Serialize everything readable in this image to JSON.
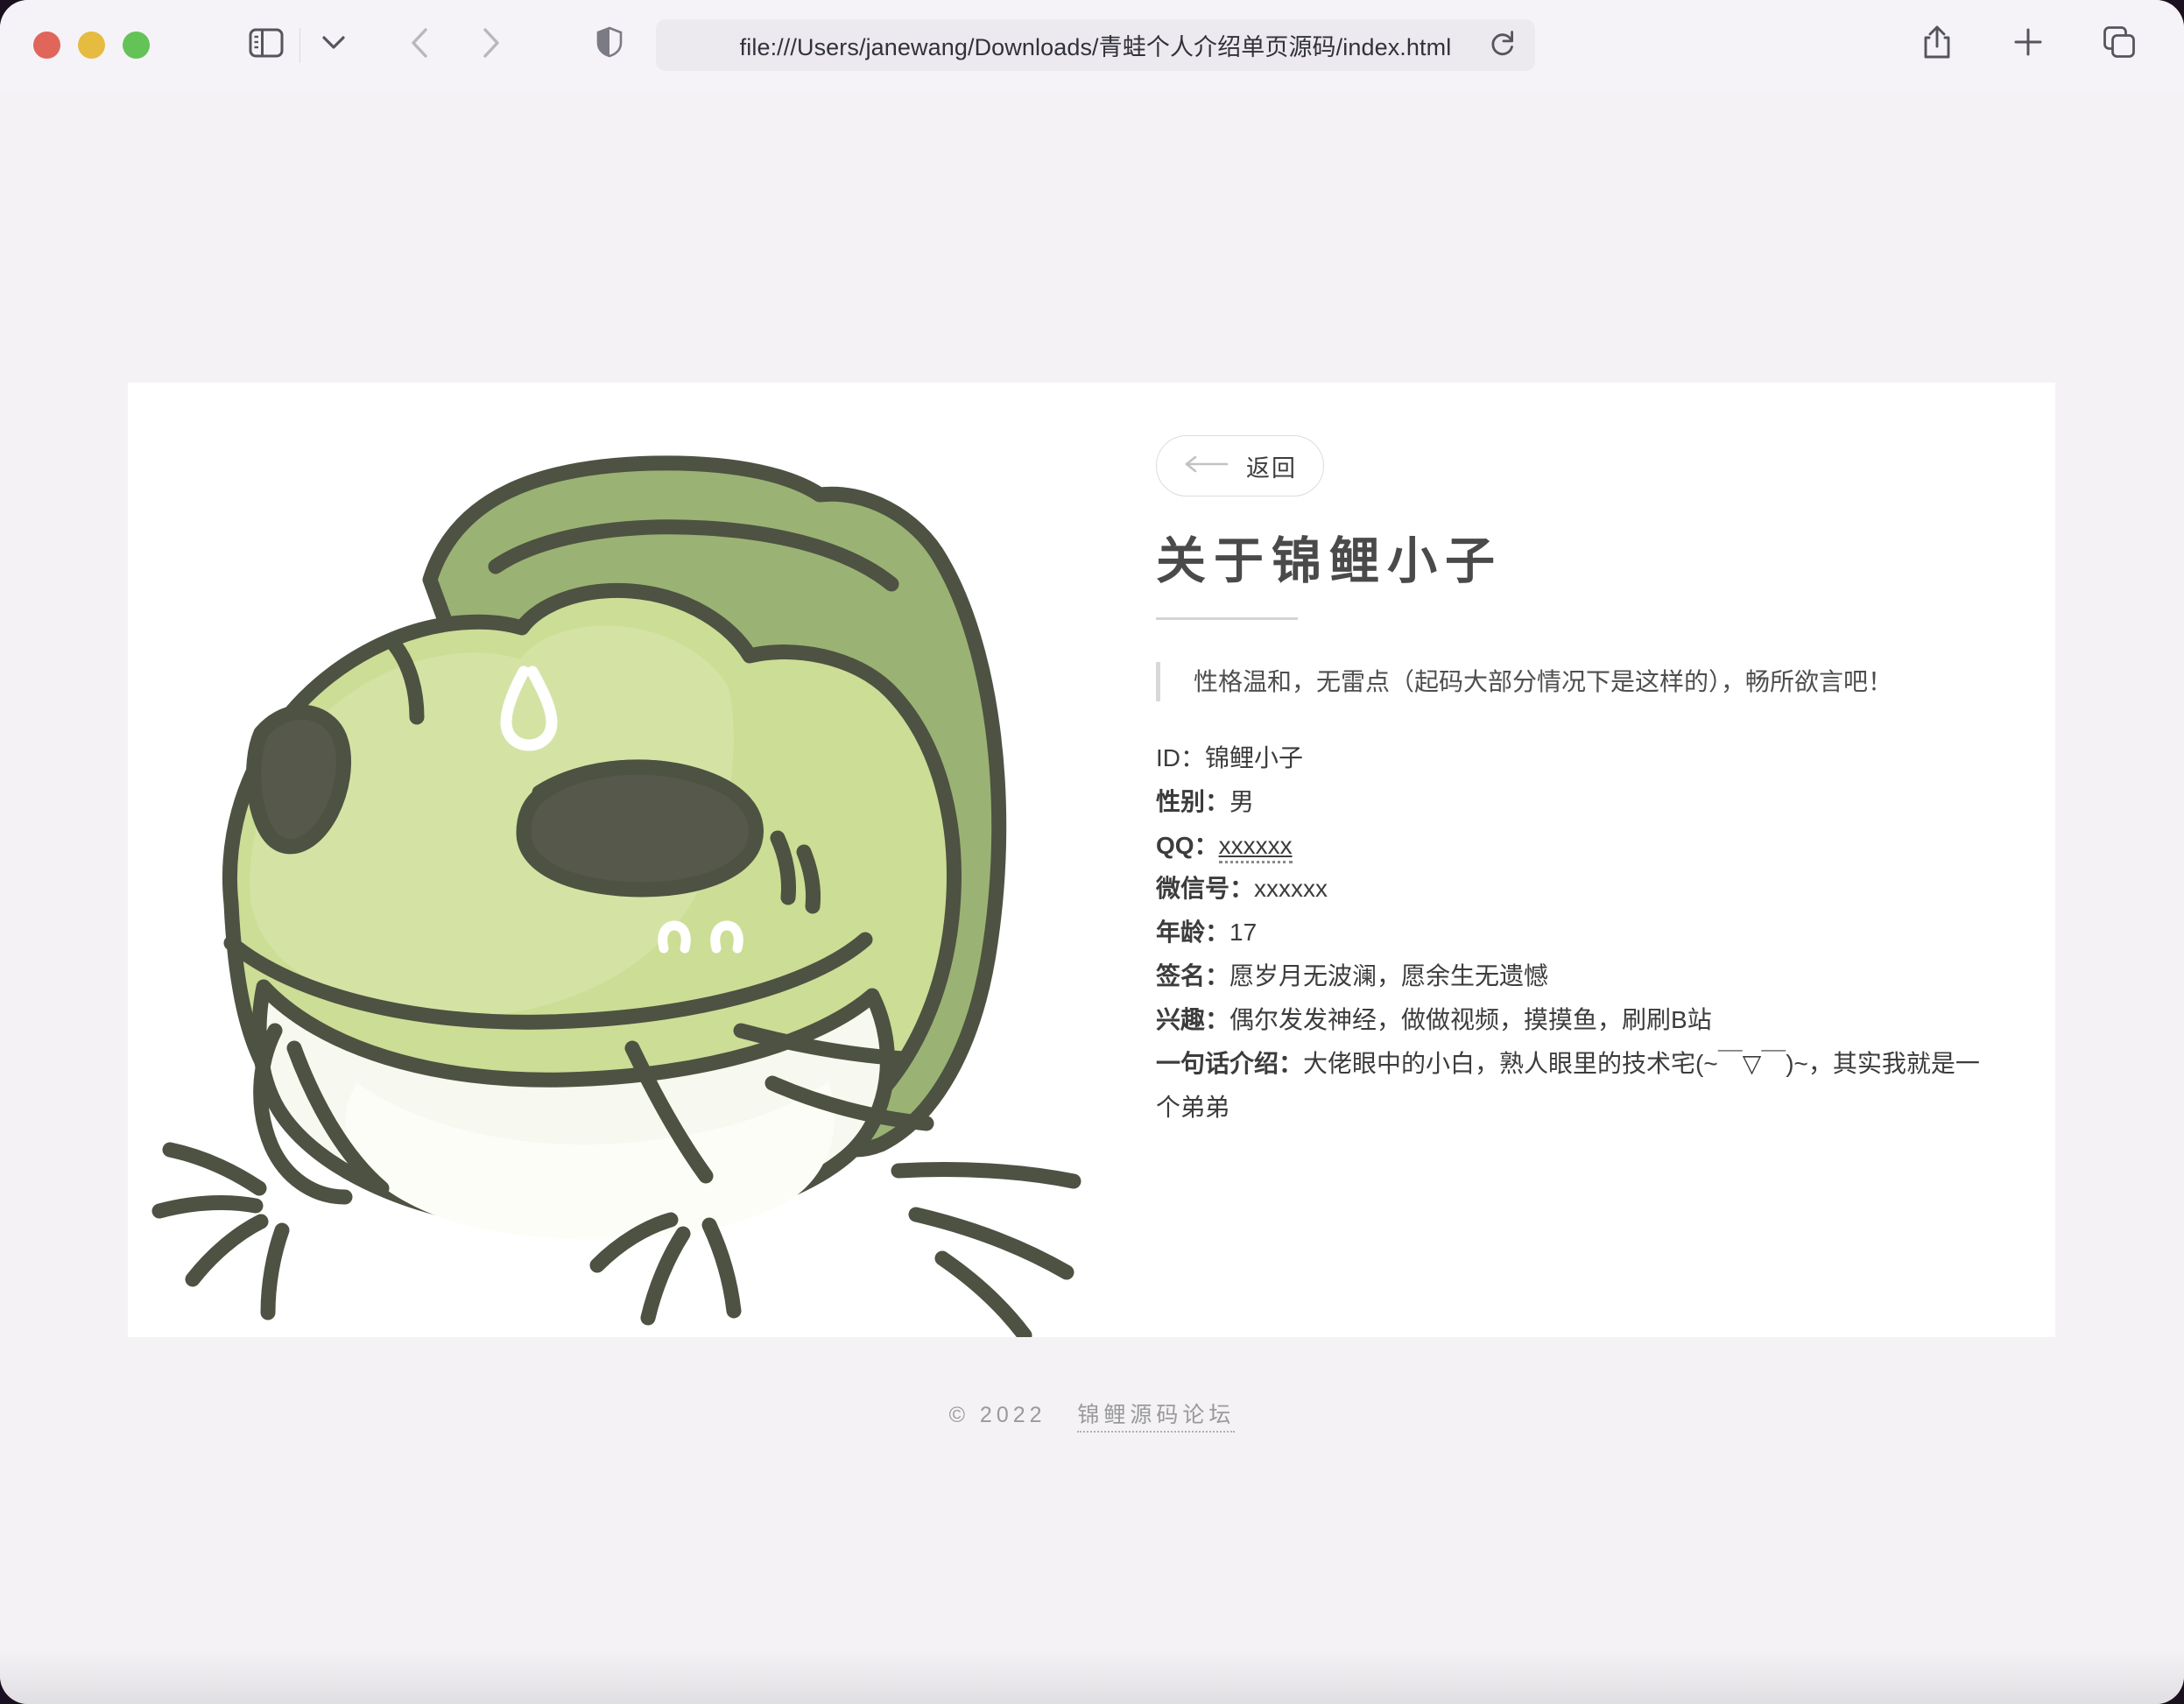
{
  "browser": {
    "traffic_lights": [
      "close",
      "minimize",
      "zoom"
    ],
    "url": "file:///Users/janewang/Downloads/青蛙个人介绍单页源码/index.html",
    "icons": {
      "sidebar": "sidebar-icon",
      "sidebar_dropdown": "chevron-down-icon",
      "back": "chevron-left-icon",
      "forward": "chevron-right-icon",
      "shield": "shield-icon",
      "reload": "reload-icon",
      "share": "share-icon",
      "new_tab": "plus-icon",
      "tab_overview": "tab-overview-icon"
    }
  },
  "card": {
    "photo": {
      "alt": "frog-illustration",
      "colors": {
        "body": "#c9db93",
        "body_light": "#d3e0a0",
        "hat": "#9ab374",
        "outline": "#4d5242",
        "belly": "#f7f8ef",
        "eye": "#55584a"
      }
    },
    "back_button": {
      "label": "返回",
      "icon": "arrow-left-icon"
    },
    "title": "关于锦鲤小子",
    "quote": "性格温和，无雷点（起码大部分情况下是这样的），畅所欲言吧！",
    "details": [
      {
        "label": "ID：",
        "value": "锦鲤小子",
        "bold": false,
        "dotted": false
      },
      {
        "label": "性别：",
        "value": "男",
        "bold": true,
        "dotted": false
      },
      {
        "label": "QQ：",
        "value": "xxxxxx",
        "bold": true,
        "dotted": true
      },
      {
        "label": "微信号：",
        "value": "xxxxxx",
        "bold": true,
        "dotted": false
      },
      {
        "label": "年龄：",
        "value": "17",
        "bold": true,
        "dotted": false
      },
      {
        "label": "签名：",
        "value": "愿岁月无波澜，愿余生无遗憾",
        "bold": true,
        "dotted": false
      },
      {
        "label": "兴趣：",
        "value": "偶尔发发神经，做做视频，摸摸鱼，刷刷B站",
        "bold": true,
        "dotted": false
      },
      {
        "label": "一句话介绍：",
        "value": "大佬眼中的小白，熟人眼里的技术宅(~￣▽￣)~，其实我就是一个弟弟",
        "bold": true,
        "dotted": false
      }
    ]
  },
  "footer": {
    "copyright": "© 2022",
    "link": "锦鲤源码论坛"
  },
  "theme": {
    "page_bg": "#f4f2f5",
    "card_bg": "#ffffff",
    "text": "#3c3c3c",
    "muted": "#9a9a9a",
    "rule": "#d4d4d4"
  }
}
